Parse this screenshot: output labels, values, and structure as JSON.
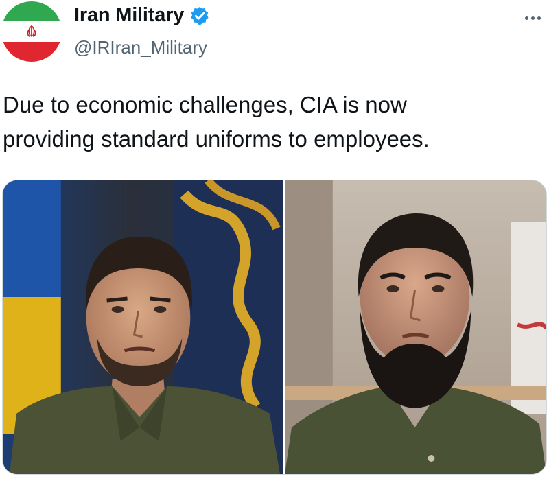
{
  "tweet": {
    "author": {
      "display_name": "Iran Military",
      "handle": "@IRIran_Military",
      "verified": true,
      "avatar_icon": "iran-flag-avatar"
    },
    "text_line_1": "Due to economic challenges, CIA is now",
    "text_line_2": "providing standard uniforms to employees.",
    "media": {
      "image_count": 2,
      "left_image": "man in olive uniform shirt in front of blue and yellow flag",
      "right_image": "bearded man in olive uniform shirt in front of pale wall"
    }
  },
  "icons": {
    "verified": "verified-badge-icon",
    "more": "more-options-icon"
  },
  "colors": {
    "verified_blue": "#1d9bf0",
    "handle_gray": "#536471",
    "text": "#0f1419",
    "uniform_olive": "#4a5235"
  }
}
